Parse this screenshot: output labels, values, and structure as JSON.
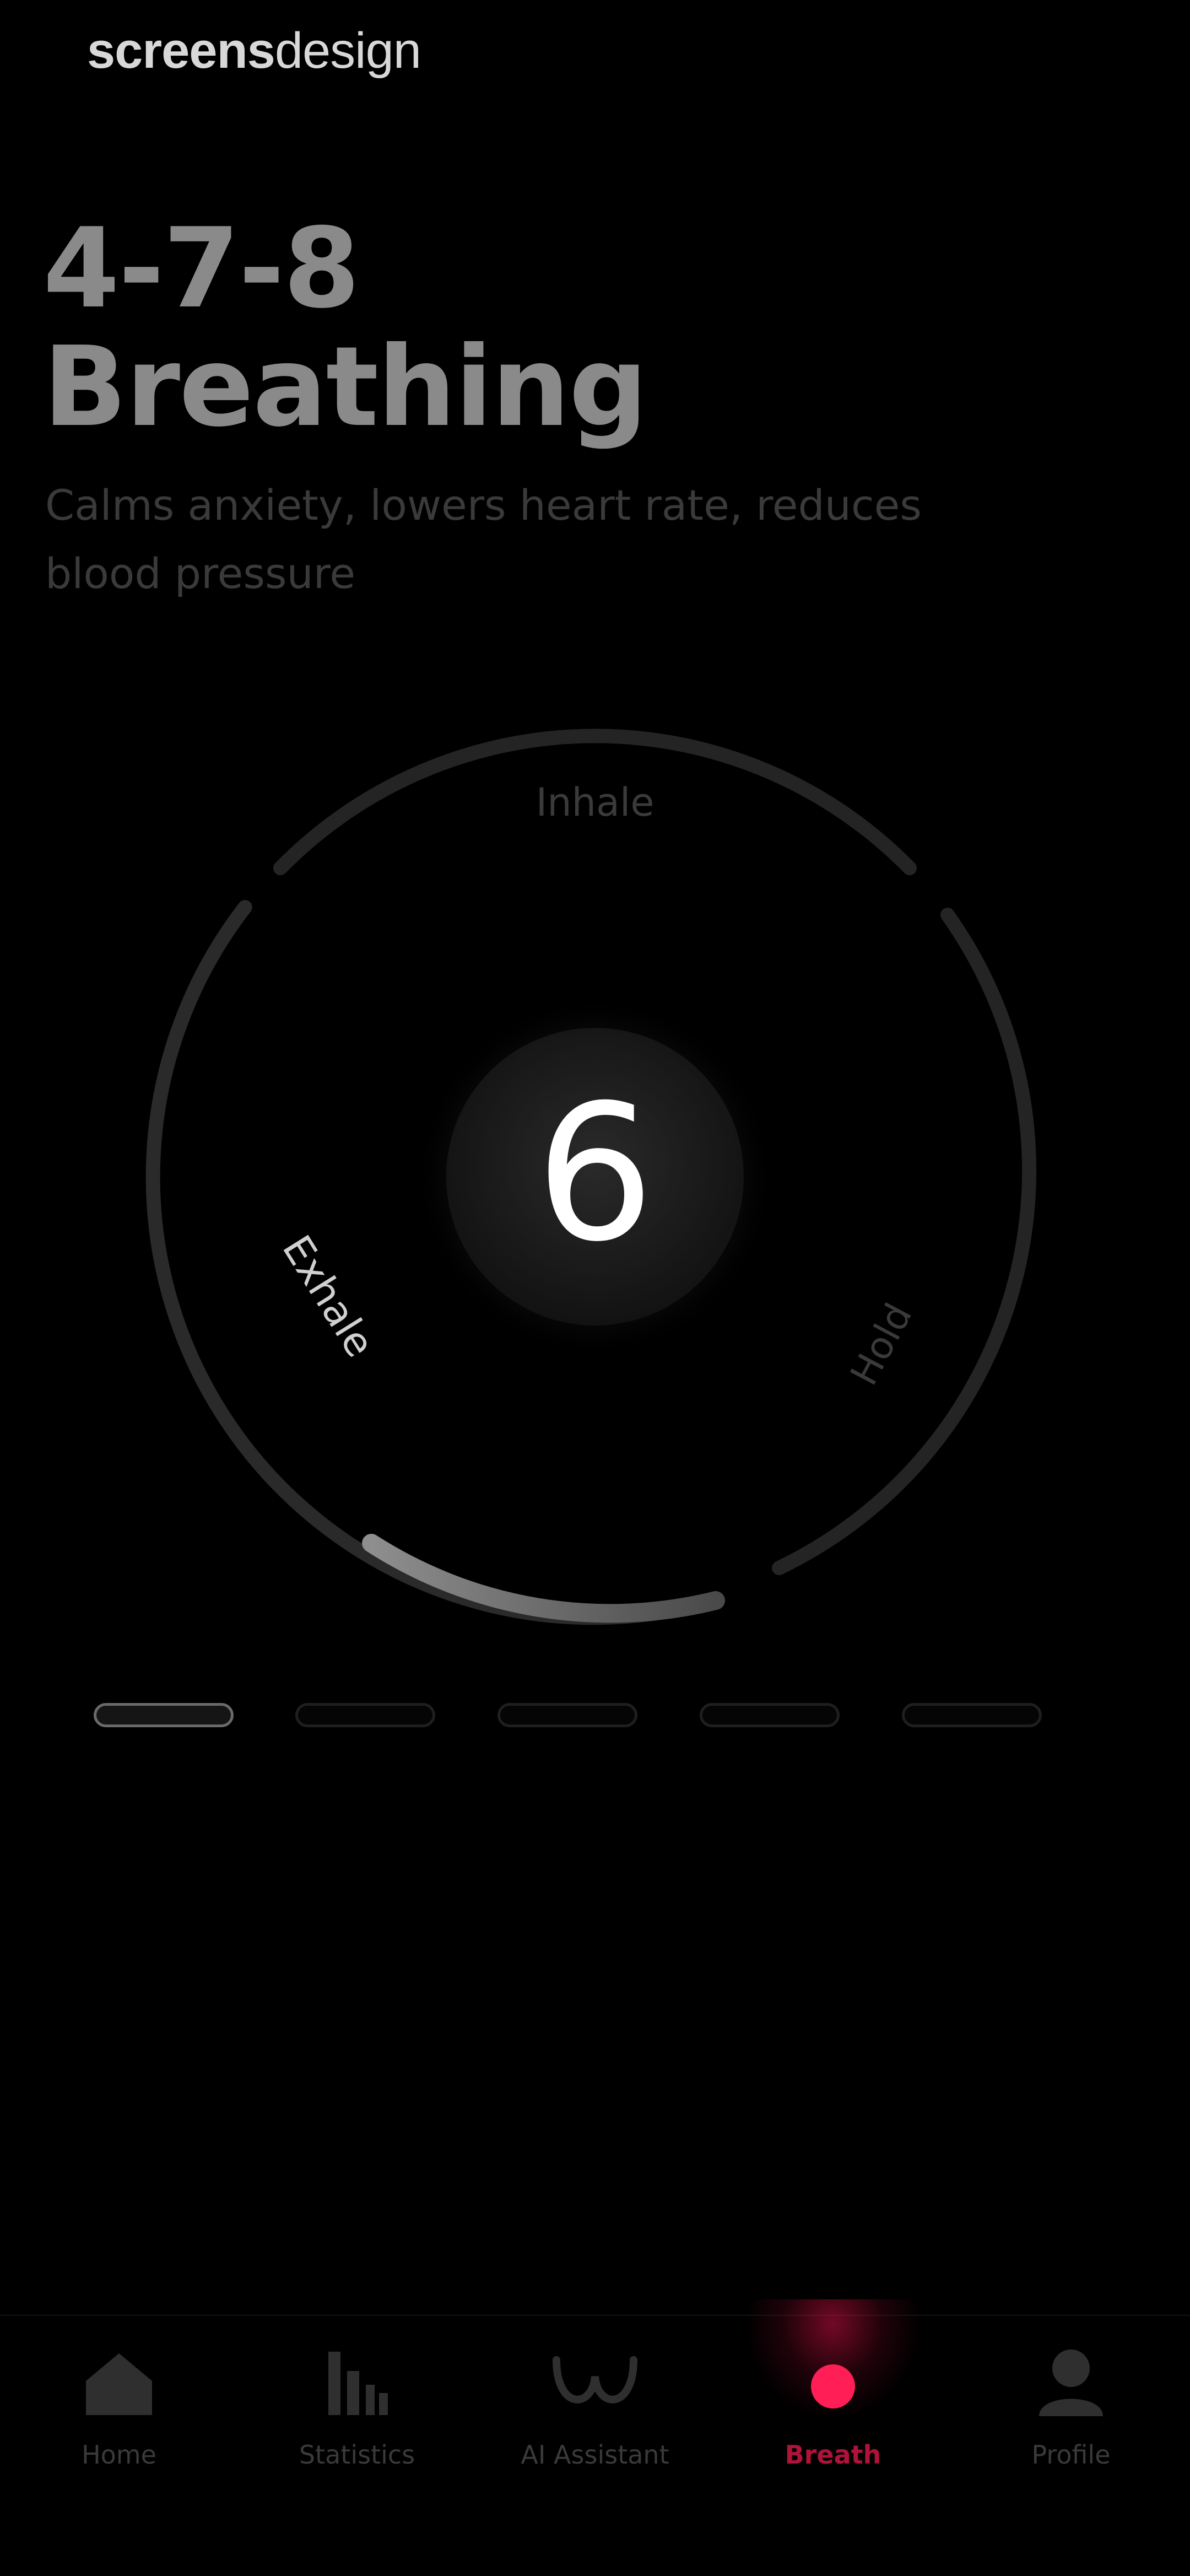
{
  "brand": {
    "part1": "screens",
    "part2": "design"
  },
  "exercise": {
    "title_line1": "4-7-8",
    "title_line2": "Breathing",
    "description": "Calms anxiety, lowers heart rate, reduces blood pressure"
  },
  "breath_cycle": {
    "phases": [
      {
        "label": "Inhale",
        "seconds": 4
      },
      {
        "label": "Hold",
        "seconds": 7
      },
      {
        "label": "Exhale",
        "seconds": 8
      }
    ],
    "current_phase": "Exhale",
    "countdown": "6",
    "phase_progress": 0.25
  },
  "pager": {
    "count": 5,
    "active_index": 0
  },
  "tab_bar": {
    "active": "Breath",
    "accent_color": "#ff1e56",
    "items": [
      {
        "label": "Home",
        "icon": "home-icon"
      },
      {
        "label": "Statistics",
        "icon": "bar-chart-icon"
      },
      {
        "label": "AI Assistant",
        "icon": "ai-assistant-icon"
      },
      {
        "label": "Breath",
        "icon": "breath-dot-icon"
      },
      {
        "label": "Profile",
        "icon": "profile-icon"
      }
    ]
  },
  "colors": {
    "background": "#000000",
    "ring": "#232323",
    "ring_progress": "#9a9a9a",
    "accent": "#ff1e56"
  }
}
